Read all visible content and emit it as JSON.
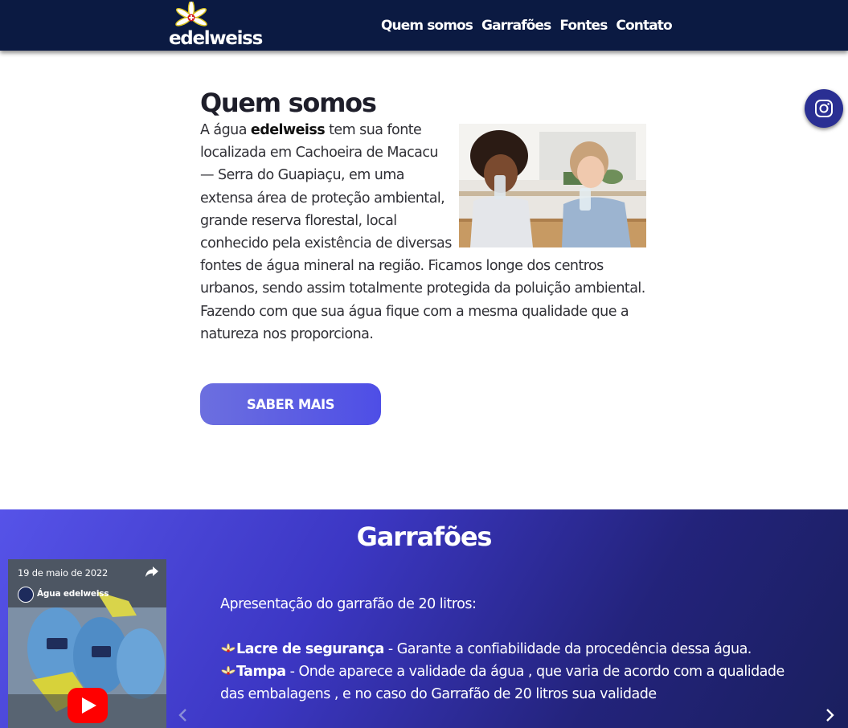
{
  "brand": {
    "name": "edelweiss"
  },
  "nav": {
    "items": [
      {
        "label": "Quem somos"
      },
      {
        "label": "Garrafões"
      },
      {
        "label": "Fontes"
      },
      {
        "label": "Contato"
      }
    ]
  },
  "social": {
    "icon": "instagram-icon"
  },
  "about": {
    "title": "Quem somos",
    "text_before": "A água ",
    "text_brand": "edelweiss",
    "text_after": " tem sua fonte localizada em Cachoeira de Macacu — Serra do Guapiaçu, em uma extensa área de proteção ambiental, grande reserva florestal, local conhecido pela existência de diversas fontes de água mineral na região. Ficamos longe dos centros urbanos, sendo assim totalmente protegida da poluição ambiental. Fazendo com que sua água fique com a mesma qualidade que a natureza nos proporciona.",
    "cta_label": "SABER MAIS"
  },
  "garrafoes": {
    "title": "Garrafões",
    "video": {
      "date": "19 de maio de 2022",
      "channel": "Água edelweiss"
    },
    "intro": "Apresentação do garrafão de 20 litros:",
    "items": [
      {
        "term": "Lacre de segurança",
        "desc": " - Garante a confiabilidade da procedência dessa água."
      },
      {
        "term": "Tampa",
        "desc": " - Onde aparece a validade da água , que varia de acordo com a qualidade das embalagens , e no caso do Garrafão de 20 litros sua validade"
      }
    ]
  },
  "colors": {
    "header_bg": "#0b1a42",
    "accent": "#5653e8",
    "cta": "#5a5ae4"
  }
}
